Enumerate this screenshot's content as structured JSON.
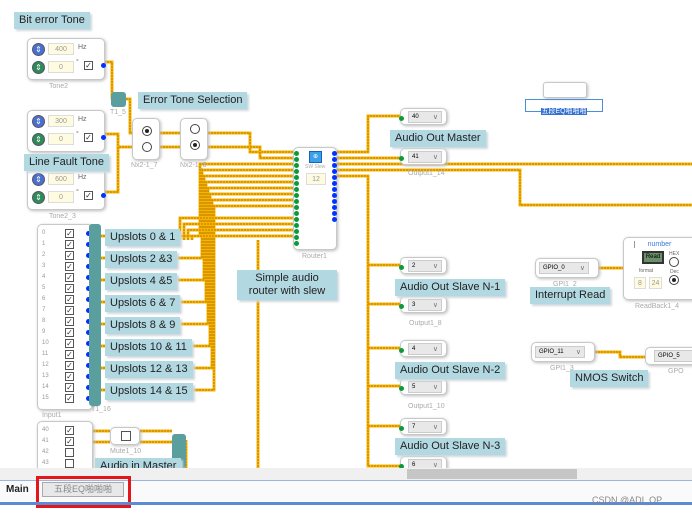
{
  "labels": {
    "bit_error_tone": "Bit error Tone",
    "error_tone_selection": "Error Tone Selection",
    "line_fault_tone": "Line Fault Tone",
    "simple_router": "Simple audio router with slew",
    "audio_out_master": "Audio Out Master",
    "slave_n1": "Audio Out Slave N-1",
    "slave_n2": "Audio Out Slave N-2",
    "slave_n3": "Audio Out Slave N-3",
    "interrupt_read": "Interrupt Read",
    "nmos_switch": "NMOS Switch",
    "audio_in_master": "Audio in Master",
    "selected_text": "五段EQ啪啪啪"
  },
  "tones": [
    {
      "name": "Tone2",
      "freq": "400",
      "phase": "0",
      "unit": "Hz",
      "deg": "°"
    },
    {
      "name": "",
      "freq": "300",
      "phase": "0",
      "unit": "Hz",
      "deg": "°"
    },
    {
      "name": "Tone2_3",
      "freq": "600",
      "phase": "0",
      "unit": "Hz",
      "deg": "°"
    }
  ],
  "blocks": {
    "t1_5": "T1_5",
    "nx7": "Nx2-1_7",
    "nx8": "Nx2-1_8",
    "router": "Router1",
    "router_slew_label": "SW Slew",
    "router_slew": "12",
    "t1_16": "T1_16",
    "input1": "Input1",
    "mute": "Mute1_10"
  },
  "upslots": [
    "Upslots 0 & 1",
    "Upslots 2 &3",
    "Upslots 4 &5",
    "Upslots 6 & 7",
    "Upslots 8 & 9",
    "Upslots 10 & 11",
    "Upslots 12 & 13",
    "Upslots 14 & 15"
  ],
  "input_rows": [
    "0",
    "1",
    "2",
    "3",
    "4",
    "5",
    "6",
    "7",
    "8",
    "9",
    "10",
    "11",
    "12",
    "13",
    "14",
    "15"
  ],
  "input2_rows": [
    "40",
    "41",
    "42",
    "43"
  ],
  "outputs": {
    "o40": "40",
    "o41": "41",
    "out14": "Output1_14",
    "o2": "2",
    "o3": "3",
    "out8": "Output1_8",
    "o4": "4",
    "o5": "5",
    "out10": "Output1_10",
    "o7": "7",
    "o6": "6"
  },
  "gpio": {
    "gpi2_val": "GPIO_0",
    "gpi2": "GPI1_2",
    "gpi3_val": "GPIO_11",
    "gpi3": "GPI1_3",
    "gpo_val": "GPIO_5",
    "gpo": "GPO"
  },
  "readback": {
    "title": "number",
    "read": "Read",
    "hex": "HEX",
    "dec": "Dec",
    "format": "format",
    "f1": "8",
    "f2": "24",
    "name": "ReadBack1_4"
  },
  "tabs": [
    {
      "label": "Main",
      "active": true
    },
    {
      "label": "五段EQ啪啪啪",
      "active": false
    }
  ],
  "watermark": "CSDN @ADI_OP",
  "colors": {
    "wire": "#f5b400",
    "highlight": "#e3161b",
    "label_bg": "#b2d8e2"
  }
}
